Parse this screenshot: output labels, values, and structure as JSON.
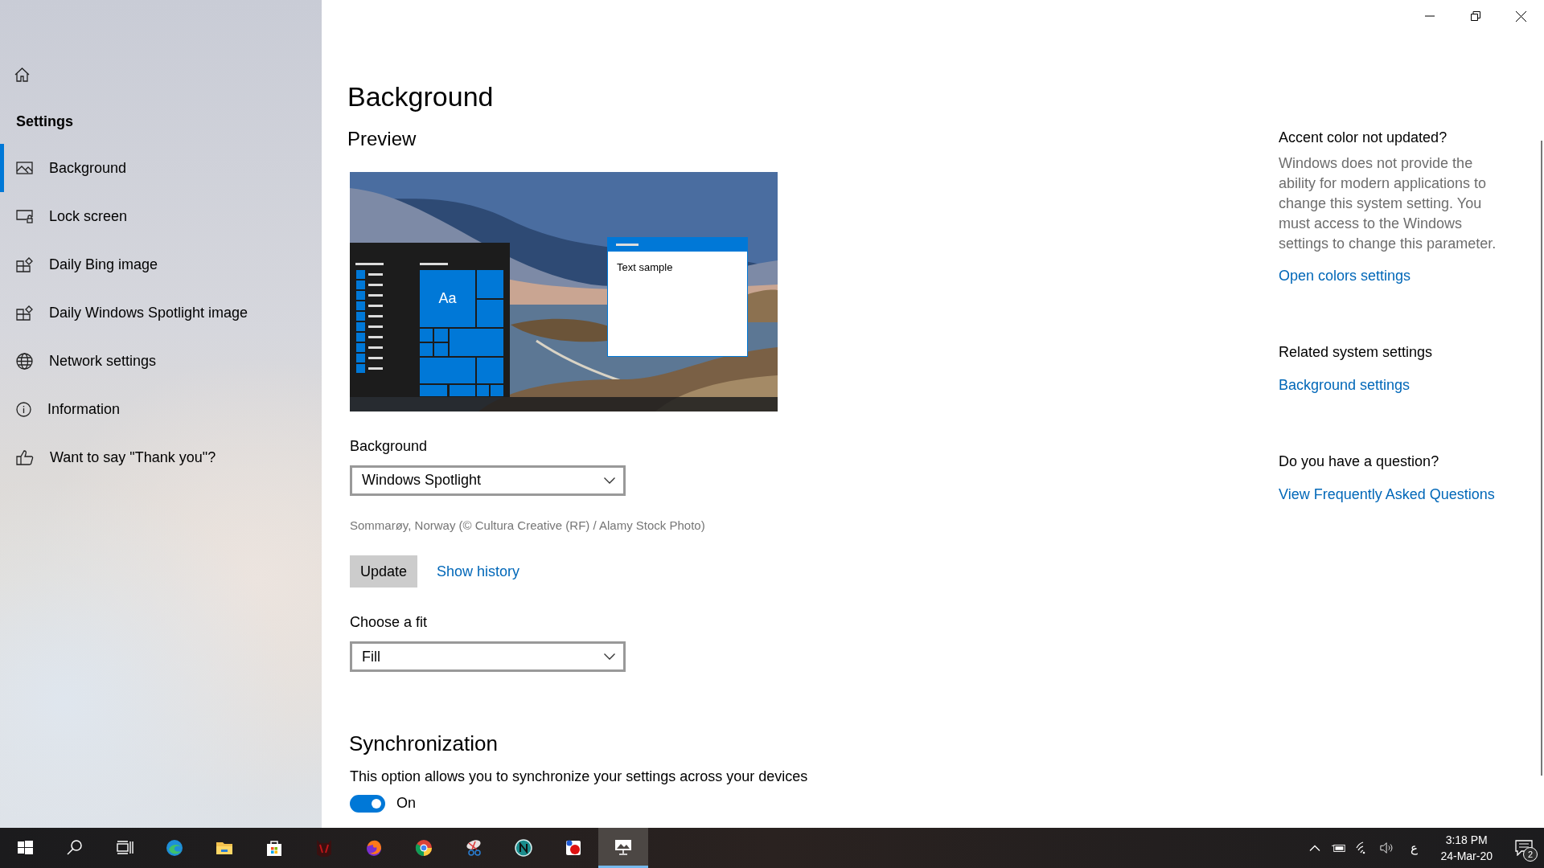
{
  "sidebar": {
    "title": "Settings",
    "items": [
      {
        "label": "Background",
        "selected": true
      },
      {
        "label": "Lock screen",
        "selected": false
      },
      {
        "label": "Daily Bing image",
        "selected": false
      },
      {
        "label": "Daily Windows Spotlight image",
        "selected": false
      },
      {
        "label": "Network settings",
        "selected": false
      },
      {
        "label": "Information",
        "selected": false
      },
      {
        "label": "Want to say \"Thank you\"?",
        "selected": false
      }
    ]
  },
  "main": {
    "title": "Background",
    "preview": {
      "heading": "Preview",
      "tile_text": "Aa",
      "window_text": "Text sample"
    },
    "background": {
      "label": "Background",
      "value": "Windows Spotlight"
    },
    "caption": "Sommarøy, Norway (© Cultura Creative (RF) / Alamy Stock Photo)",
    "update_button": "Update",
    "history_link": "Show history",
    "fit": {
      "label": "Choose a fit",
      "value": "Fill"
    },
    "sync": {
      "heading": "Synchronization",
      "description": "This option allows you to synchronize your settings across your devices",
      "toggle": {
        "on": true,
        "label": "On"
      }
    }
  },
  "aside": [
    {
      "heading": "Accent color not updated?",
      "text": "Windows does not provide the ability for modern applications to change this system setting. You must access to the Windows settings to change this parameter.",
      "link": "Open colors settings"
    },
    {
      "heading": "Related system settings",
      "link": "Background settings"
    },
    {
      "heading": "Do you have a question?",
      "link": "View Frequently Asked Questions"
    }
  ],
  "taskbar": {
    "apps": [
      {
        "selected": false
      },
      {
        "selected": false
      },
      {
        "selected": false
      },
      {
        "selected": false
      },
      {
        "selected": false
      },
      {
        "selected": false
      },
      {
        "selected": false
      },
      {
        "selected": false
      },
      {
        "selected": false
      },
      {
        "selected": false
      },
      {
        "selected": false
      },
      {
        "selected": false
      },
      {
        "selected": true
      }
    ],
    "language": "ع",
    "time": "3:18 PM",
    "date": "24-Mar-20",
    "notifications": "2"
  }
}
